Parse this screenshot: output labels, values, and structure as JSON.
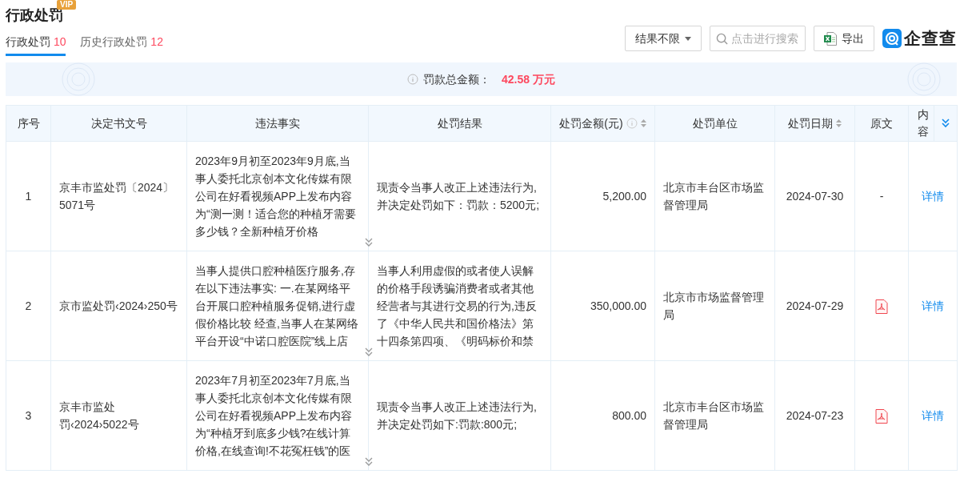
{
  "page": {
    "title": "行政处罚",
    "badge": "VIP"
  },
  "tabs": [
    {
      "label": "行政处罚",
      "count": "10",
      "selected": true
    },
    {
      "label": "历史行政处罚",
      "count": "12",
      "selected": false
    }
  ],
  "toolbar": {
    "filter": "结果不限",
    "search": {
      "placeholder": "点击进行搜索"
    },
    "export": "导出",
    "brand": "企查查"
  },
  "summary": {
    "label": "罚款总金额：",
    "value": "42.58 万元"
  },
  "table": {
    "columns": [
      {
        "label": "序号",
        "info": false,
        "sortable": false
      },
      {
        "label": "决定书文号",
        "info": false,
        "sortable": false
      },
      {
        "label": "违法事实",
        "info": false,
        "sortable": false
      },
      {
        "label": "处罚结果",
        "info": false,
        "sortable": false
      },
      {
        "label": "处罚金额(元)",
        "info": true,
        "sortable": true
      },
      {
        "label": "处罚单位",
        "info": false,
        "sortable": false
      },
      {
        "label": "处罚日期",
        "info": false,
        "sortable": true
      },
      {
        "label": "原文",
        "info": false,
        "sortable": false
      },
      {
        "label": "内容",
        "info": false,
        "sortable": false
      }
    ],
    "rows": [
      {
        "no": "1",
        "doc_no": "京丰市监处罚〔2024〕5071号",
        "facts": "2023年9月初至2023年9月底,当事人委托北京创本文化传媒有限公司在好看视频APP上发布内容为“测一测！适合您的种植牙需要多少钱？全新种植牙价格",
        "result": "现责令当事人改正上述违法行为,并决定处罚如下：罚款：5200元;",
        "amount": "5,200.00",
        "agency": "北京市丰台区市场监督管理局",
        "date": "2024-07-30",
        "original": {
          "kind": "none",
          "text": "-"
        },
        "detail": "详情"
      },
      {
        "no": "2",
        "doc_no": "京市监处罚‹2024›250号",
        "facts": "当事人提供口腔种植医疗服务,存在以下违法事实: 一.在某网络平台开展口腔种植服务促销,进行虚假价格比较 经查,当事人在某网络平台开设“中诺口腔医院”线上店",
        "result": "当事人利用虚假的或者使人误解的价格手段诱骗消费者或者其他经营者与其进行交易的行为,违反了《中华人民共和国价格法》第十四条第四项、《明码标价和禁",
        "amount": "350,000.00",
        "agency": "北京市市场监督管理局",
        "date": "2024-07-29",
        "original": {
          "kind": "pdf"
        },
        "detail": "详情"
      },
      {
        "no": "3",
        "doc_no": "京丰市监处罚‹2024›5022号",
        "facts": "2023年7月初至2023年7月底,当事人委托北京创本文化传媒有限公司在好看视频APP上发布内容为“种植牙到底多少钱?在线计算价格,在线查询!不花冤枉钱”的医",
        "result": "现责令当事人改正上述违法行为,并决定处罚如下:罚款:800元;",
        "amount": "800.00",
        "agency": "北京市丰台区市场监督管理局",
        "date": "2024-07-23",
        "original": {
          "kind": "pdf"
        },
        "detail": "详情"
      }
    ]
  }
}
